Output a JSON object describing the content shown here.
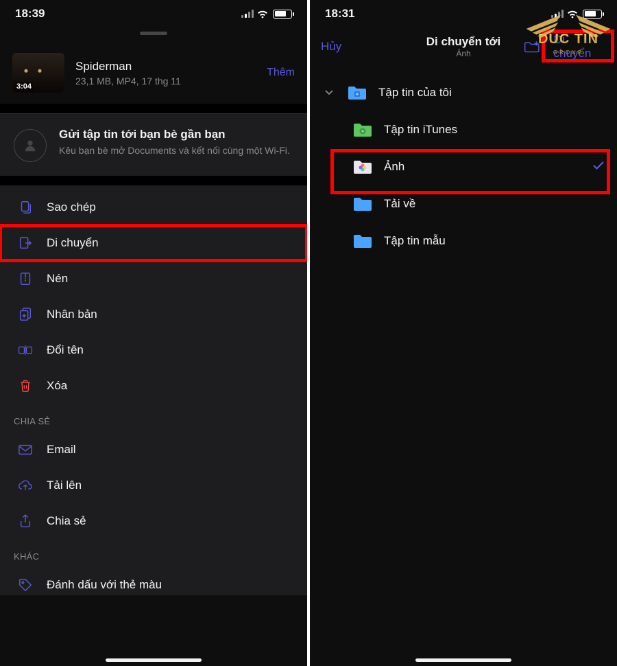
{
  "left": {
    "time": "18:39",
    "file": {
      "name": "Spiderman",
      "meta": "23,1 MB, MP4, 17 thg 11",
      "duration": "3:04"
    },
    "more_label": "Thêm",
    "nearby": {
      "title": "Gửi tập tin tới bạn bè gần bạn",
      "desc": "Kêu bạn bè mở Documents và kết nối cùng một Wi-Fi."
    },
    "actions": {
      "copy": "Sao chép",
      "move": "Di chuyển",
      "compress": "Nén",
      "duplicate": "Nhân bản",
      "rename": "Đổi tên",
      "delete": "Xóa"
    },
    "share_section": "CHIA SẺ",
    "share": {
      "email": "Email",
      "upload": "Tải lên",
      "share": "Chia sẻ"
    },
    "other_section": "KHÁC",
    "other": {
      "tag": "Đánh dấu với thẻ màu"
    }
  },
  "right": {
    "time": "18:31",
    "nav": {
      "cancel": "Hủy",
      "title": "Di chuyển tới",
      "subtitle": "Ảnh",
      "move": "Di chuyển"
    },
    "folders": {
      "myfiles": "Tập tin của tôi",
      "itunes": "Tập tin iTunes",
      "photos": "Ảnh",
      "downloads": "Tải về",
      "samples": "Tập tin mẫu"
    }
  },
  "logo": {
    "brand": "DUC TIN",
    "sub": "GROUP"
  }
}
